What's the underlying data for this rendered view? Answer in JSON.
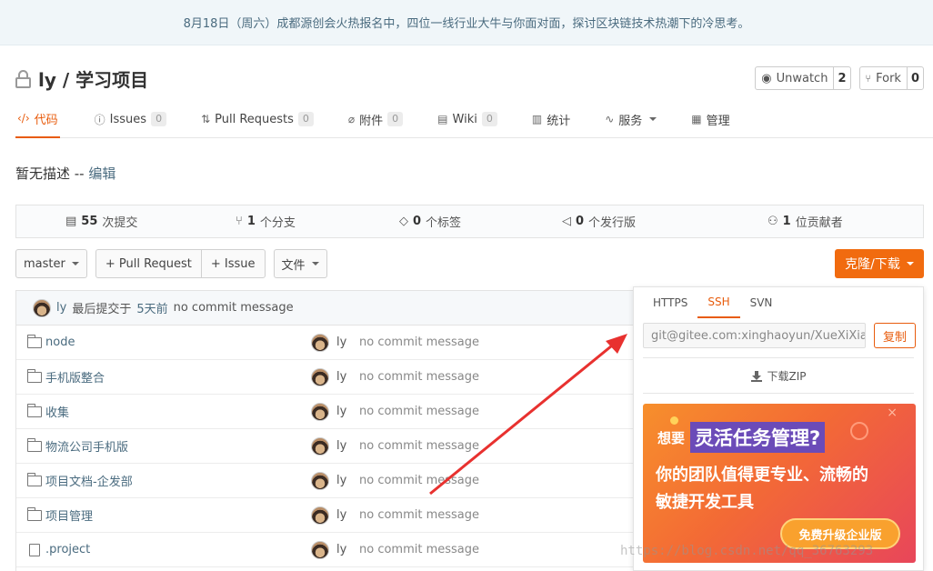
{
  "banner": {
    "text": "8月18日（周六）成都源创会火热报名中，四位一线行业大牛与你面对面，探讨区块链技术热潮下的冷思考。"
  },
  "repo": {
    "owner": "ly",
    "separator": " / ",
    "name": "学习项目"
  },
  "watch": {
    "label": "Unwatch",
    "count": "2"
  },
  "fork": {
    "label": "Fork",
    "count": "0"
  },
  "tabs": [
    {
      "label": "代码",
      "icon": "code-icon",
      "count": ""
    },
    {
      "label": "Issues",
      "icon": "issue-icon",
      "count": "0"
    },
    {
      "label": "Pull Requests",
      "icon": "pull-request-icon",
      "count": "0"
    },
    {
      "label": "附件",
      "icon": "attachment-icon",
      "count": "0"
    },
    {
      "label": "Wiki",
      "icon": "wiki-icon",
      "count": "0"
    },
    {
      "label": "统计",
      "icon": "stats-icon",
      "count": ""
    },
    {
      "label": "服务",
      "icon": "service-icon",
      "count": ""
    },
    {
      "label": "管理",
      "icon": "manage-icon",
      "count": ""
    }
  ],
  "description": {
    "text": "暂无描述 -- ",
    "edit": "编辑"
  },
  "stats": {
    "commits": {
      "num": "55",
      "label": "次提交"
    },
    "branches": {
      "num": "1",
      "label": "个分支"
    },
    "tags": {
      "num": "0",
      "label": "个标签"
    },
    "releases": {
      "num": "0",
      "label": "个发行版"
    },
    "contributors": {
      "num": "1",
      "label": "位贡献者"
    }
  },
  "toolbar": {
    "branch": "master",
    "pull_request": "+ Pull Request",
    "issue": "+ Issue",
    "file": "文件",
    "clone": "克隆/下载"
  },
  "last_commit": {
    "author": "ly",
    "text": "最后提交于",
    "time": "5天前",
    "message": "no commit message"
  },
  "files": [
    {
      "type": "folder",
      "name": "node",
      "author": "ly",
      "message": "no commit message"
    },
    {
      "type": "folder",
      "name": "手机版整合",
      "author": "ly",
      "message": "no commit message"
    },
    {
      "type": "folder",
      "name": "收集",
      "author": "ly",
      "message": "no commit message"
    },
    {
      "type": "folder",
      "name": "物流公司手机版",
      "author": "ly",
      "message": "no commit message"
    },
    {
      "type": "folder",
      "name": "项目文档-企发部",
      "author": "ly",
      "message": "no commit message"
    },
    {
      "type": "folder",
      "name": "项目管理",
      "author": "ly",
      "message": "no commit message"
    },
    {
      "type": "file",
      "name": ".project",
      "author": "ly",
      "message": "no commit message"
    }
  ],
  "clone_popup": {
    "tabs": [
      "HTTPS",
      "SSH",
      "SVN"
    ],
    "active_tab": "SSH",
    "url": "git@gitee.com:xinghaoyun/XueXiXiangMu.git",
    "copy": "复制",
    "download": "下载ZIP"
  },
  "ad": {
    "prefix": "想要",
    "highlight": "灵活任务管理?",
    "line1": "你的团队值得更专业、流畅的",
    "line2": "敏捷开发工具",
    "cta": "免费升级企业版"
  },
  "watermark": "https://blog.csdn.net/qq_36763293",
  "colors": {
    "accent": "#e85c0d",
    "clone_button": "#f16b0f",
    "link": "#4a6b7f",
    "arrow": "#e8312f"
  }
}
